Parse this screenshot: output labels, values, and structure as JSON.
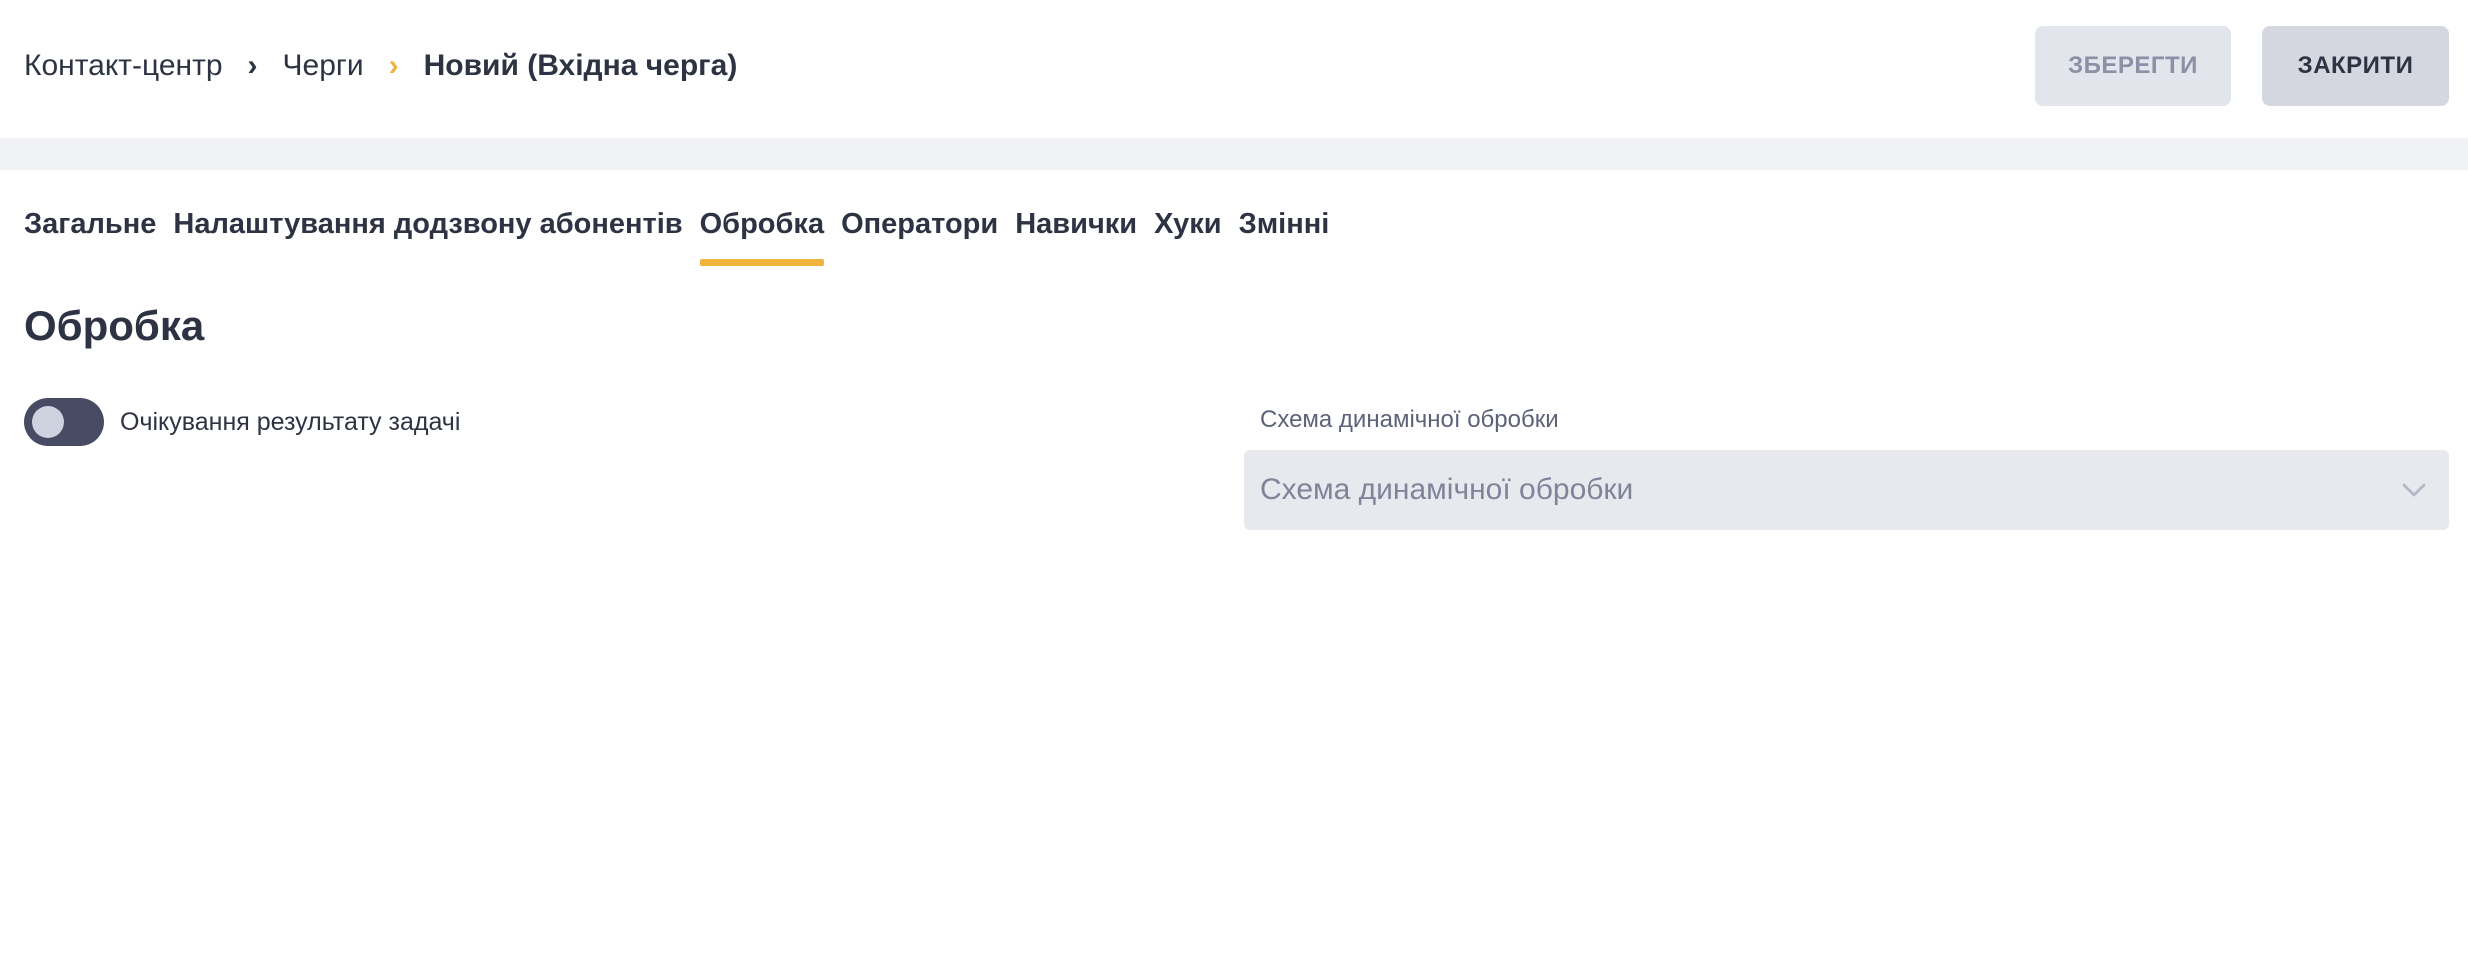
{
  "breadcrumb": {
    "items": [
      "Контакт-центр",
      "Черги",
      "Новий (Вхідна черга)"
    ]
  },
  "toolbar": {
    "save_label": "ЗБЕРЕГТИ",
    "close_label": "ЗАКРИТИ"
  },
  "tabs": [
    {
      "label": "Загальне",
      "active": false
    },
    {
      "label": "Налаштування додзвону абонентів",
      "active": false
    },
    {
      "label": "Обробка",
      "active": true
    },
    {
      "label": "Оператори",
      "active": false
    },
    {
      "label": "Навички",
      "active": false
    },
    {
      "label": "Хуки",
      "active": false
    },
    {
      "label": "Змінні",
      "active": false
    }
  ],
  "section": {
    "title": "Обробка",
    "toggle_label": "Очікування результату задачі",
    "toggle_on": false,
    "scheme_label": "Схема динамічної обробки",
    "scheme_placeholder": "Схема динамічної обробки"
  },
  "colors": {
    "accent": "#f0b33e",
    "text": "#2e3344",
    "toggle_track": "#474c64"
  }
}
